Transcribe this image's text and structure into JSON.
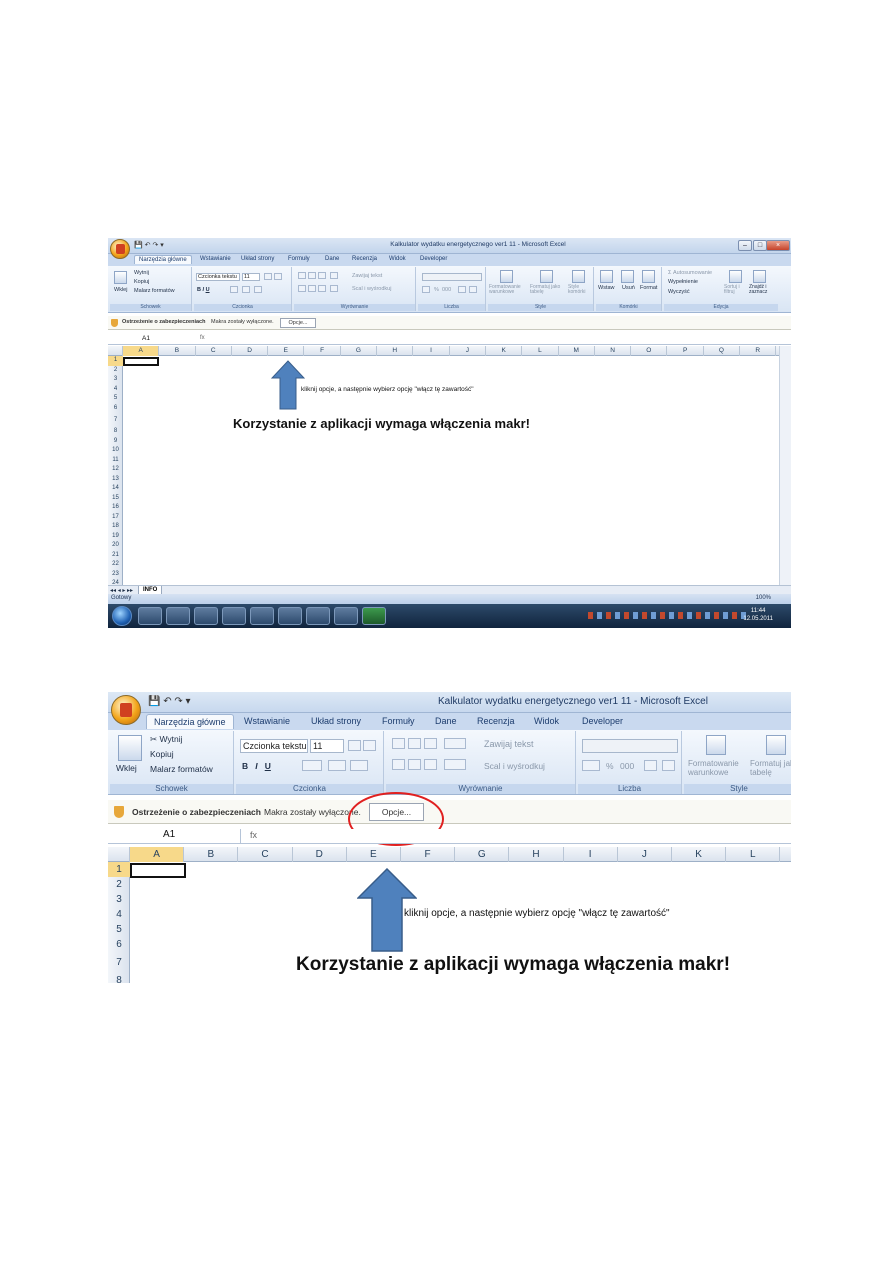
{
  "window": {
    "title": "Kalkulator wydatku energetycznego ver1 11 - Microsoft Excel",
    "title_zoom": "Kalkulator wydatku energetycznego ver1 11 - Microsoft Excel"
  },
  "tabs": [
    "Narzędzia główne",
    "Wstawianie",
    "Układ strony",
    "Formuły",
    "Dane",
    "Recenzja",
    "Widok",
    "Developer"
  ],
  "ribbon": {
    "clipboard": {
      "paste": "Wklej",
      "cut": "Wytnij",
      "copy": "Kopiuj",
      "painter": "Malarz formatów",
      "group": "Schowek"
    },
    "font": {
      "name": "Czcionka tekstu",
      "size": "11",
      "group": "Czcionka"
    },
    "alignment": {
      "wrap": "Zawijaj tekst",
      "merge": "Scal i wyśrodkuj",
      "group": "Wyrównanie"
    },
    "number": {
      "group": "Liczba",
      "percent": "%",
      "thousands": "000"
    },
    "styles": {
      "cond": "Formatowanie warunkowe",
      "table": "Formatuj jako tabelę",
      "cell": "Style komórki",
      "group": "Style"
    },
    "cells": {
      "insert": "Wstaw",
      "delete": "Usuń",
      "format": "Format",
      "group": "Komórki"
    },
    "editing": {
      "autosum": "Autosumowanie",
      "fill": "Wypełnienie",
      "clear": "Wyczyść",
      "sort": "Sortuj i filtruj",
      "find": "Znajdź i zaznacz",
      "group": "Edycja"
    }
  },
  "security": {
    "warning": "Ostrzeżenie o zabezpieczeniach",
    "message": "Makra zostały wyłączone.",
    "options": "Opcje..."
  },
  "formula": {
    "cell": "A1",
    "fx": "fx"
  },
  "columns_small": [
    "A",
    "B",
    "C",
    "D",
    "E",
    "F",
    "G",
    "H",
    "I",
    "J",
    "K",
    "L",
    "M",
    "N",
    "O",
    "P",
    "Q",
    "R"
  ],
  "columns_zoom": [
    "A",
    "B",
    "C",
    "D",
    "E",
    "F",
    "G",
    "H",
    "I",
    "J",
    "K",
    "L"
  ],
  "rows_small": [
    "1",
    "2",
    "3",
    "4",
    "5",
    "6",
    "7",
    "8",
    "9",
    "10",
    "11",
    "12",
    "13",
    "14",
    "15",
    "16",
    "17",
    "18",
    "19",
    "20",
    "21",
    "22",
    "23",
    "24"
  ],
  "rows_zoom": [
    "1",
    "2",
    "3",
    "4",
    "5",
    "6",
    "7",
    "8"
  ],
  "content": {
    "hint": "kliknij opcje, a następnie wybierz opcję \"włącz tę zawartość\"",
    "headline": "Korzystanie z aplikacji wymaga włączenia makr!"
  },
  "sheet": {
    "tab": "INFO"
  },
  "status": {
    "ready": "Gotowy",
    "zoom": "100%"
  },
  "taskbar": {
    "time": "11:44",
    "date": "12.05.2011"
  },
  "colors": {
    "ribbon": "#d9e5f4",
    "arrow": "#4f81bd",
    "circle": "#e02020"
  }
}
